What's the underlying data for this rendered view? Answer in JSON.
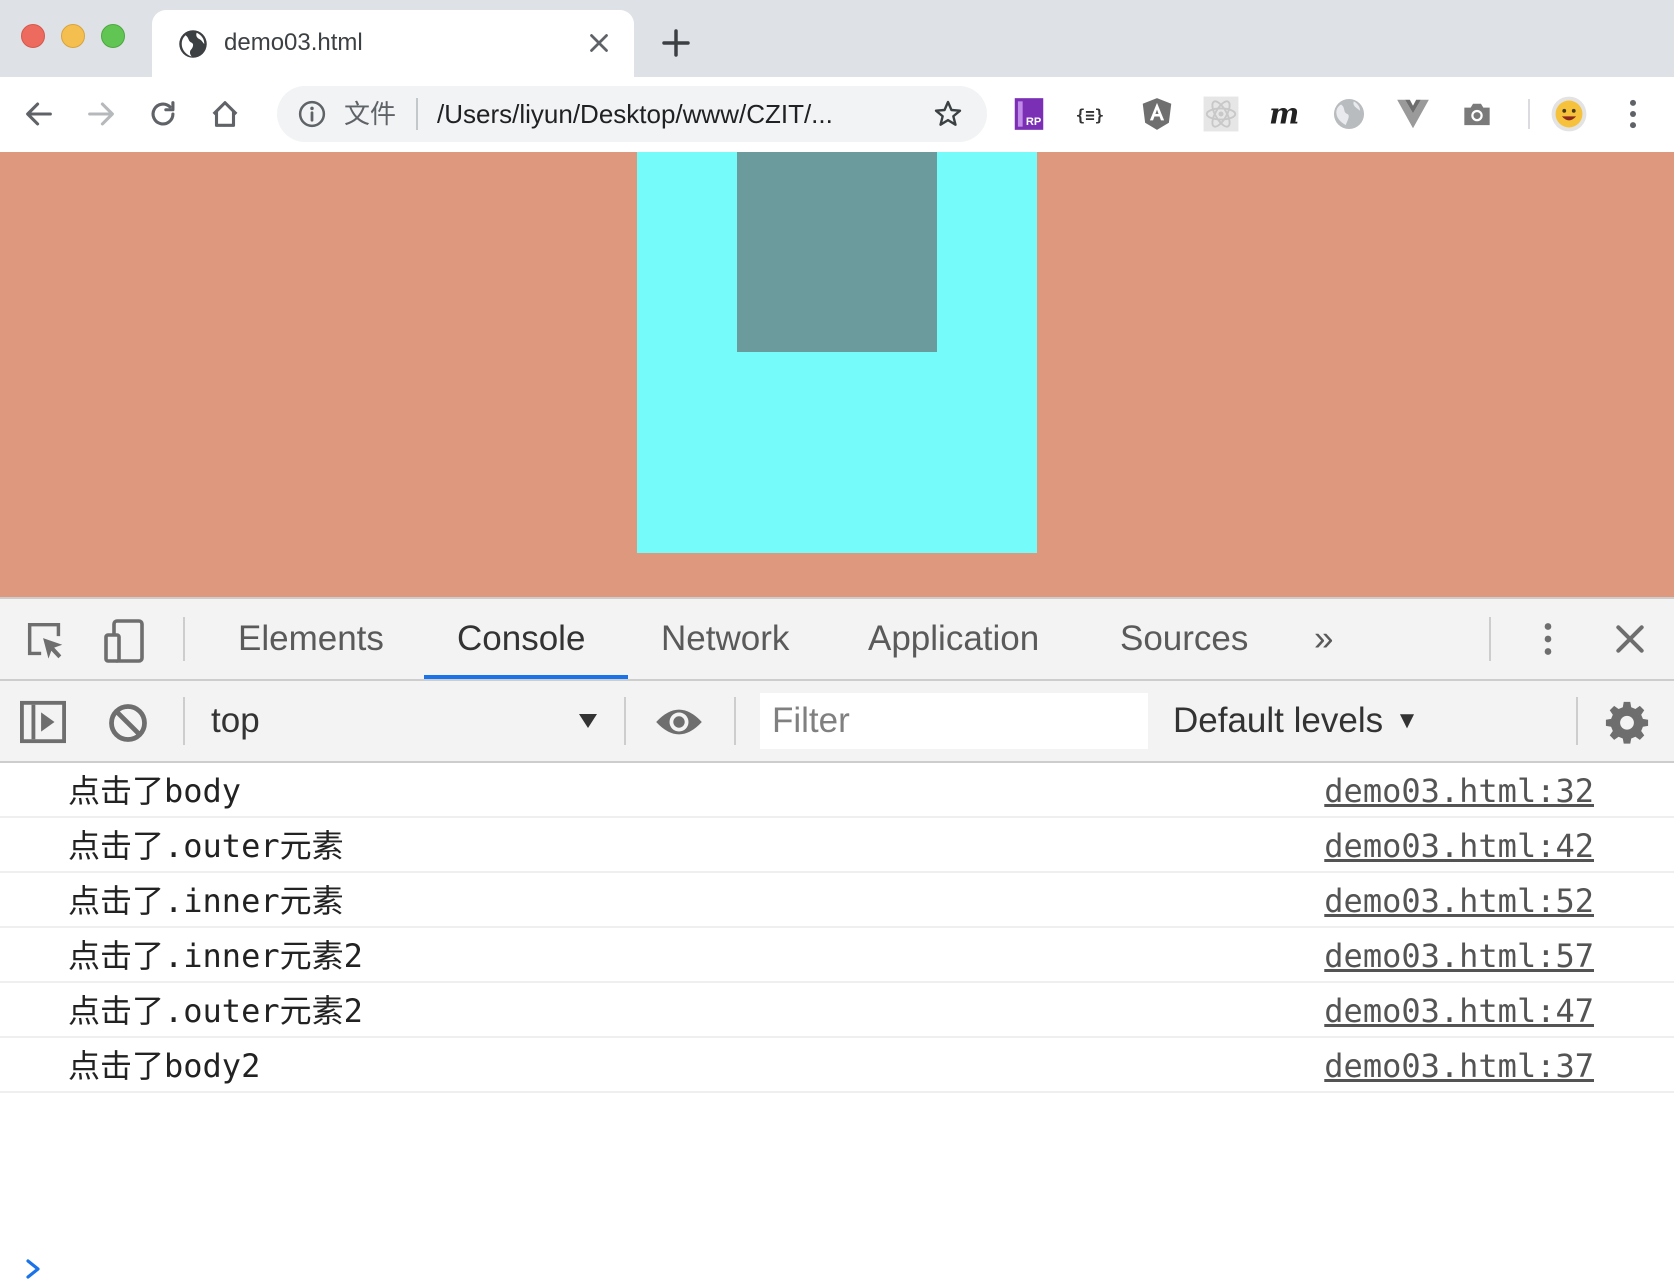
{
  "browser": {
    "tab": {
      "title": "demo03.html",
      "icon": "globe-icon"
    },
    "new_tab_icon": "plus-icon",
    "nav": {
      "back_icon": "back-arrow-icon",
      "forward_icon": "forward-arrow-icon",
      "reload_icon": "reload-icon",
      "home_icon": "home-icon"
    },
    "omnibox": {
      "info_icon": "info-icon",
      "label": "文件",
      "url": "/Users/liyun/Desktop/www/CZIT/...",
      "bookmark_icon": "star-icon"
    },
    "extensions": [
      "axure-rp-icon",
      "json-formatter-icon",
      "angular-icon",
      "react-icon",
      "m-icon",
      "globe-extension-icon",
      "vue-icon",
      "camera-icon"
    ],
    "profile_icon": "emoji-avatar-icon",
    "menu_icon": "kebab-menu-icon"
  },
  "page": {
    "body_color": "#de987d",
    "outer_color": "#76fbfb",
    "inner_color": "#6b9b9c"
  },
  "devtools": {
    "tabs": [
      {
        "label": "Elements"
      },
      {
        "label": "Console"
      },
      {
        "label": "Network"
      },
      {
        "label": "Application"
      },
      {
        "label": "Sources"
      }
    ],
    "active_tab": "Console",
    "more_tabs_label": "»",
    "console_bar": {
      "context": "top",
      "filter_placeholder": "Filter",
      "levels": "Default levels"
    },
    "logs": [
      {
        "message": "点击了body",
        "source": "demo03.html:32"
      },
      {
        "message": "点击了.outer元素",
        "source": "demo03.html:42"
      },
      {
        "message": "点击了.inner元素",
        "source": "demo03.html:52"
      },
      {
        "message": "点击了.inner元素2",
        "source": "demo03.html:57"
      },
      {
        "message": "点击了.outer元素2",
        "source": "demo03.html:47"
      },
      {
        "message": "点击了body2",
        "source": "demo03.html:37"
      }
    ],
    "accent_color": "#1a73e8"
  }
}
